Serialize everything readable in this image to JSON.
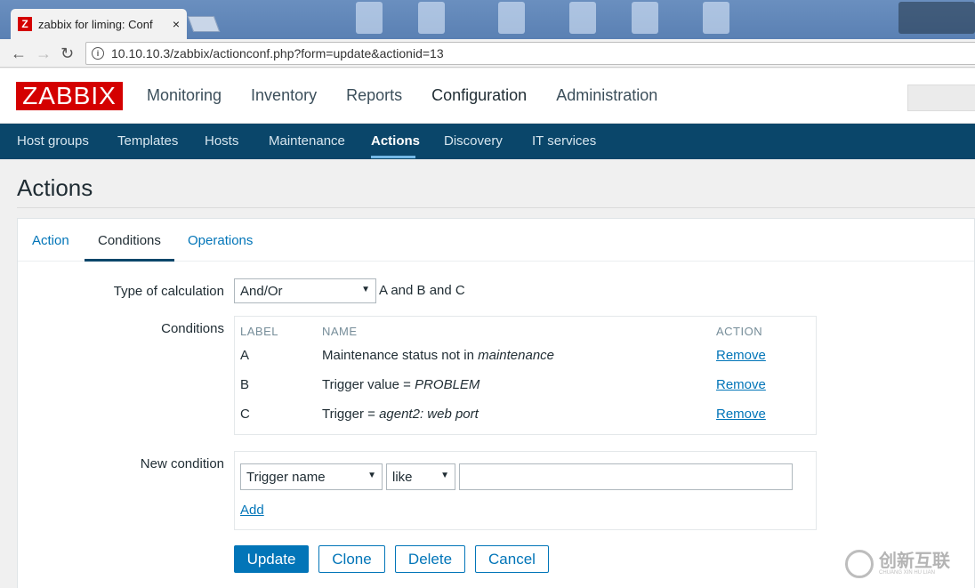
{
  "browser": {
    "tab_title": "zabbix for liming: Conf",
    "tab_close": "×",
    "favicon_letter": "Z",
    "url": "10.10.10.3/zabbix/actionconf.php?form=update&actionid=13",
    "info_glyph": "i",
    "back_glyph": "←",
    "forward_glyph": "→",
    "reload_glyph": "↻"
  },
  "header": {
    "logo": "ZABBIX",
    "nav": [
      "Monitoring",
      "Inventory",
      "Reports",
      "Configuration",
      "Administration"
    ],
    "active_nav": "Configuration"
  },
  "subnav": {
    "items": [
      "Host groups",
      "Templates",
      "Hosts",
      "Maintenance",
      "Actions",
      "Discovery",
      "IT services"
    ],
    "active": "Actions"
  },
  "page": {
    "title": "Actions",
    "tabs": [
      "Action",
      "Conditions",
      "Operations"
    ],
    "active_tab": "Conditions"
  },
  "form": {
    "calc_label": "Type of calculation",
    "calc_value": "And/Or",
    "calc_formula": "A and B and C",
    "conditions_label": "Conditions",
    "table_headers": {
      "label": "LABEL",
      "name": "NAME",
      "action": "ACTION"
    },
    "conditions": [
      {
        "label": "A",
        "name_prefix": "Maintenance status not in ",
        "name_value": "maintenance",
        "action": "Remove"
      },
      {
        "label": "B",
        "name_prefix": "Trigger value = ",
        "name_value": "PROBLEM",
        "action": "Remove"
      },
      {
        "label": "C",
        "name_prefix": "Trigger = ",
        "name_value": "agent2: web port",
        "action": "Remove"
      }
    ],
    "new_condition_label": "New condition",
    "new_condition_type": "Trigger name",
    "new_condition_operator": "like",
    "new_condition_value": "",
    "add_link": "Add"
  },
  "buttons": {
    "update": "Update",
    "clone": "Clone",
    "delete": "Delete",
    "cancel": "Cancel"
  },
  "colors": {
    "brand": "#d40000",
    "subnav_bg": "#0a466a",
    "link": "#0275b8"
  },
  "watermark": {
    "text": "创新互联",
    "sub": "CHUANG XIN HU LIAN"
  }
}
